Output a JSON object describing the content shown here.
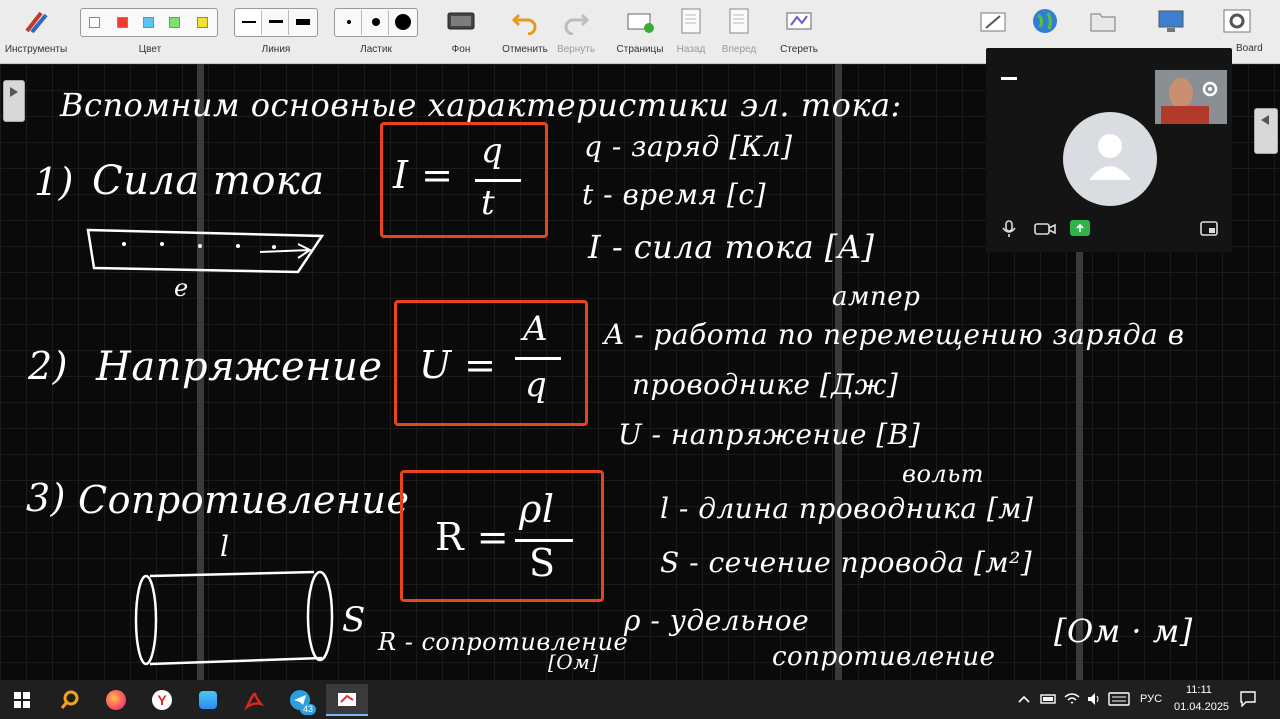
{
  "toolbar": {
    "tools_label": "Инструменты",
    "color_label": "Цвет",
    "line_label": "Линия",
    "eraser_label": "Ластик",
    "background_label": "Фон",
    "undo_label": "Отменить",
    "redo_label": "Вернуть",
    "pages_label": "Страницы",
    "back_label": "Назад",
    "forward_label": "Вперед",
    "erase_label": "Стереть",
    "board_label": "Board",
    "colors": [
      "#ffffff",
      "#f03c2e",
      "#5cc4f2",
      "#7de36a",
      "#f2e034"
    ]
  },
  "board": {
    "title": "Вспомним основные характеристики эл. тока:",
    "item1": {
      "number": "1)",
      "name": "Сила тока",
      "formula_lhs": "I =",
      "formula_num": "q",
      "formula_den": "t",
      "def1": "q - заряд [Кл]",
      "def2": "t - время [с]",
      "def3": "I - сила тока [A]",
      "unit_name": "ампер",
      "wire_label": "e"
    },
    "item2": {
      "number": "2)",
      "name": "Напряжение",
      "formula_lhs": "U =",
      "formula_num": "A",
      "formula_den": "q",
      "def1": "A - работа по перемещению заряда в",
      "def1b": "проводнике [Дж]",
      "def2": "U - напряжение [B]",
      "unit_name": "вольт"
    },
    "item3": {
      "number": "3)",
      "name": "Сопротивление",
      "formula_lhs": "R =",
      "formula_num": "ρl",
      "formula_den": "S",
      "def1": "l - длина проводника [м]",
      "def2": "S - сечение провода [м²]",
      "def3": "ρ - удельное",
      "def3b": "сопротивление",
      "def3_unit": "[Ом · м]",
      "r_def": "R - сопротивление",
      "r_unit": "[Ом]",
      "cyl_l": "l",
      "cyl_s": "S"
    }
  },
  "taskbar": {
    "lang": "РУС",
    "time": "11:11",
    "date": "01.04.2025",
    "badge": "43"
  }
}
